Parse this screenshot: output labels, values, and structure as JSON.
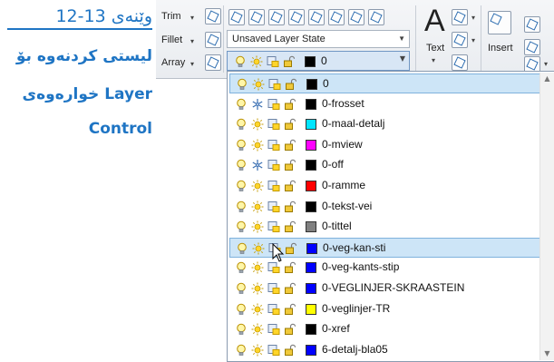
{
  "caption": {
    "figure_number": "وێنەی 13-12",
    "line1": "لیستی کردنەوە بۆ",
    "line2": "خوارەوەی Layer",
    "line3": "Control"
  },
  "ribbon": {
    "trim": "Trim",
    "fillet": "Fillet",
    "array": "Array",
    "layer_state": "Unsaved Layer State",
    "current_layer": "0",
    "text_label": "Text",
    "insert_label": "Insert"
  },
  "colors": {
    "accent": "#1f75c4",
    "highlight": "#cde5f7"
  },
  "layers": [
    {
      "name": "0",
      "color": "#000000",
      "on_icon": "bulb-icon",
      "freeze_icon": "sun-icon",
      "highlighted": true
    },
    {
      "name": "0-frosset",
      "color": "#000000",
      "on_icon": "bulb-icon",
      "freeze_icon": "snowflake-icon"
    },
    {
      "name": "0-maal-detalj",
      "color": "#00e5ff",
      "on_icon": "bulb-icon",
      "freeze_icon": "sun-icon"
    },
    {
      "name": "0-mview",
      "color": "#ff00ff",
      "on_icon": "bulb-icon",
      "freeze_icon": "sun-icon"
    },
    {
      "name": "0-off",
      "color": "#000000",
      "on_icon": "bulb-icon",
      "freeze_icon": "snowflake-icon"
    },
    {
      "name": "0-ramme",
      "color": "#ff0000",
      "on_icon": "bulb-icon",
      "freeze_icon": "sun-icon"
    },
    {
      "name": "0-tekst-vei",
      "color": "#000000",
      "on_icon": "bulb-icon",
      "freeze_icon": "sun-icon"
    },
    {
      "name": "0-tittel",
      "color": "#808080",
      "on_icon": "bulb-icon",
      "freeze_icon": "sun-icon"
    },
    {
      "name": "0-veg-kan-sti",
      "color": "#0000ff",
      "on_icon": "bulb-icon",
      "freeze_icon": "sun-icon",
      "highlighted": true
    },
    {
      "name": "0-veg-kants-stip",
      "color": "#0000ff",
      "on_icon": "bulb-icon",
      "freeze_icon": "sun-icon"
    },
    {
      "name": "0-VEGLINJER-SKRAASTEIN",
      "color": "#0000ff",
      "on_icon": "bulb-icon",
      "freeze_icon": "sun-icon"
    },
    {
      "name": "0-veglinjer-TR",
      "color": "#ffff00",
      "on_icon": "bulb-icon",
      "freeze_icon": "sun-icon"
    },
    {
      "name": "0-xref",
      "color": "#000000",
      "on_icon": "bulb-icon",
      "freeze_icon": "sun-icon"
    },
    {
      "name": "6-detalj-bla05",
      "color": "#0000ff",
      "on_icon": "bulb-icon",
      "freeze_icon": "sun-icon"
    }
  ]
}
